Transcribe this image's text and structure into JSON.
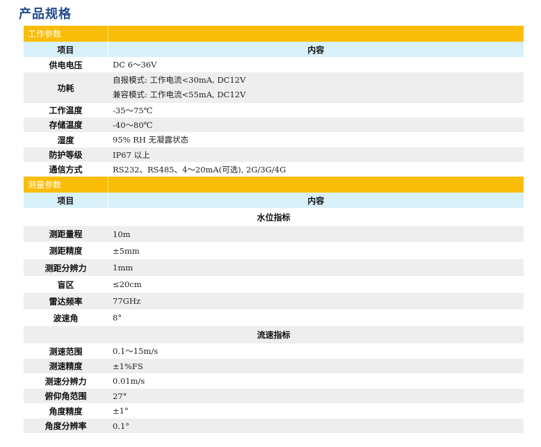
{
  "title": "产品规格",
  "colors": {
    "section": "#f9bd07",
    "header": "#d8f0f9",
    "title": "#1f4a8a",
    "stripe": "#eeeeee"
  },
  "working": {
    "section": "工作参数",
    "header": {
      "item": "项目",
      "content": "内容"
    },
    "rows": [
      {
        "label": "供电电压",
        "value": "DC 6～36V"
      },
      {
        "label": "功耗",
        "value": "自报模式: 工作电流<30mA, DC12V",
        "value2": "兼容模式: 工作电流<55mA, DC12V"
      },
      {
        "label": "工作温度",
        "value": "-35～75℃"
      },
      {
        "label": "存储温度",
        "value": "-40～80℃"
      },
      {
        "label": "湿度",
        "value": "95% RH 无凝露状态"
      },
      {
        "label": "防护等级",
        "value": "IP67 以上"
      },
      {
        "label": "通信方式",
        "value": "RS232、RS485、4～20mA(可选), 2G/3G/4G"
      }
    ]
  },
  "measure": {
    "section": "测量参数",
    "header": {
      "item": "项目",
      "content": "内容"
    },
    "water": {
      "title": "水位指标",
      "rows": [
        {
          "label": "测距量程",
          "value": "10m"
        },
        {
          "label": "测距精度",
          "value": "±5mm"
        },
        {
          "label": "测距分辨力",
          "value": "1mm"
        },
        {
          "label": "盲区",
          "value": "≤20cm"
        },
        {
          "label": "雷达频率",
          "value": "77GHz"
        },
        {
          "label": "波速角",
          "value": "8°"
        }
      ]
    },
    "flow": {
      "title": "流速指标",
      "rows": [
        {
          "label": "测速范围",
          "value": "0.1～15m/s"
        },
        {
          "label": "测速精度",
          "value": "±1%FS"
        },
        {
          "label": "测速分辨力",
          "value": "0.01m/s"
        },
        {
          "label": "俯仰角范围",
          "value": "27°"
        },
        {
          "label": "角度精度",
          "value": "±1°"
        },
        {
          "label": "角度分辨率",
          "value": "0.1°"
        }
      ]
    }
  }
}
